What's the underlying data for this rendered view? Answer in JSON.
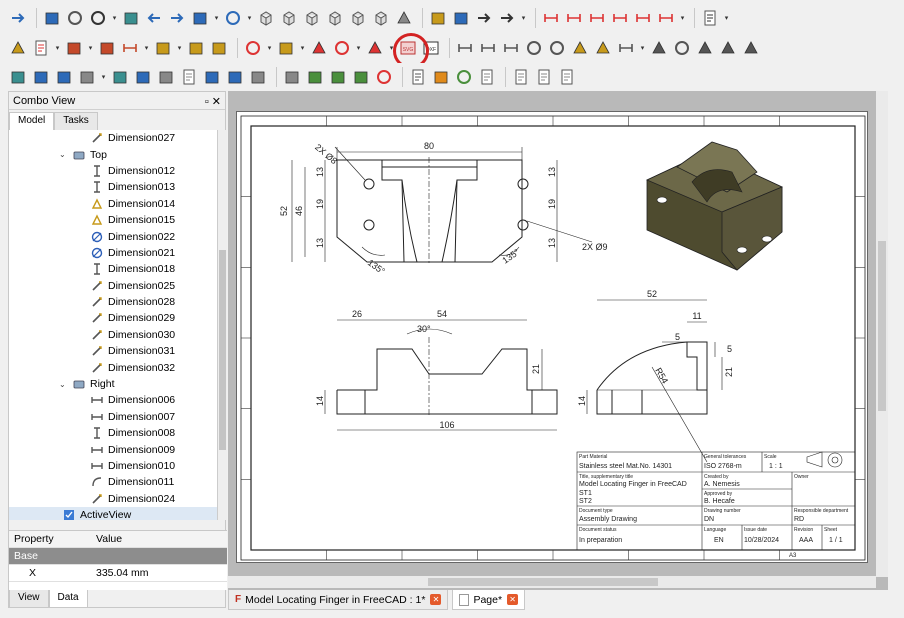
{
  "combo_view": {
    "title": "Combo View",
    "tabs": [
      "Model",
      "Tasks"
    ],
    "tree": [
      {
        "label": "Dimension027",
        "indent": 2,
        "icon": "distance"
      },
      {
        "label": "Top",
        "indent": 1,
        "icon": "view",
        "expanded": true
      },
      {
        "label": "Dimension012",
        "indent": 2,
        "icon": "vertical"
      },
      {
        "label": "Dimension013",
        "indent": 2,
        "icon": "vertical"
      },
      {
        "label": "Dimension014",
        "indent": 2,
        "icon": "angle"
      },
      {
        "label": "Dimension015",
        "indent": 2,
        "icon": "angle"
      },
      {
        "label": "Dimension022",
        "indent": 2,
        "icon": "diameter"
      },
      {
        "label": "Dimension021",
        "indent": 2,
        "icon": "diameter"
      },
      {
        "label": "Dimension018",
        "indent": 2,
        "icon": "vertical"
      },
      {
        "label": "Dimension025",
        "indent": 2,
        "icon": "distance"
      },
      {
        "label": "Dimension028",
        "indent": 2,
        "icon": "distance"
      },
      {
        "label": "Dimension029",
        "indent": 2,
        "icon": "distance"
      },
      {
        "label": "Dimension030",
        "indent": 2,
        "icon": "distance"
      },
      {
        "label": "Dimension031",
        "indent": 2,
        "icon": "distance"
      },
      {
        "label": "Dimension032",
        "indent": 2,
        "icon": "distance"
      },
      {
        "label": "Right",
        "indent": 1,
        "icon": "view",
        "expanded": true
      },
      {
        "label": "Dimension006",
        "indent": 2,
        "icon": "horizontal"
      },
      {
        "label": "Dimension007",
        "indent": 2,
        "icon": "horizontal"
      },
      {
        "label": "Dimension008",
        "indent": 2,
        "icon": "vertical"
      },
      {
        "label": "Dimension009",
        "indent": 2,
        "icon": "horizontal"
      },
      {
        "label": "Dimension010",
        "indent": 2,
        "icon": "horizontal"
      },
      {
        "label": "Dimension011",
        "indent": 2,
        "icon": "radius"
      },
      {
        "label": "Dimension024",
        "indent": 2,
        "icon": "distance"
      },
      {
        "label": "ActiveView",
        "indent": 1,
        "icon": "active",
        "selected": true
      }
    ],
    "properties": {
      "headers": [
        "Property",
        "Value"
      ],
      "group": "Base",
      "rows": [
        {
          "name": "X",
          "value": "335.04 mm"
        }
      ]
    },
    "bottom_tabs": [
      "View",
      "Data"
    ]
  },
  "document_tabs": [
    {
      "label": "Model Locating Finger in FreeCAD : 1*",
      "active": false
    },
    {
      "label": "Page*",
      "active": true
    }
  ],
  "drawing": {
    "dimensions": {
      "top_width": "80",
      "top_holes": "2X Ø8",
      "top_holes2": "2X Ø9",
      "top_h52": "52",
      "top_h46": "46",
      "top_h13a": "13",
      "top_h19a": "19",
      "top_h13b": "13",
      "top_r13a": "13",
      "top_r19": "19",
      "top_r13b": "13",
      "top_ang1": "135°",
      "top_ang2": "135°",
      "front_26": "26",
      "front_54": "54",
      "front_30": "30°",
      "front_21": "21",
      "front_14": "14",
      "front_106": "106",
      "side_52": "52",
      "side_11": "11",
      "side_5a": "5",
      "side_5b": "5",
      "side_R54": "R54",
      "side_21": "21",
      "side_14": "14"
    },
    "title_block": {
      "part_material_label": "Part Material",
      "part_material": "Stainless steel Mat.No. 14301",
      "tolerances_label": "General tolerances",
      "tolerances": "ISO 2768-m",
      "scale_label": "Scale",
      "scale": "1 : 1",
      "title_label": "Title, supplementary title",
      "title": "Model Locating Finger in FreeCAD",
      "st1": "ST1",
      "st2": "ST2",
      "created_label": "Created by",
      "created": "A. Nemesis",
      "owner_label": "Owner",
      "approved_label": "Approved by",
      "approved": "B. Hecafe",
      "doctype_label": "Document type",
      "doctype": "Assembly Drawing",
      "drawing_no_label": "Drawing number",
      "drawing_no": "DN",
      "dept_label": "Responsible department",
      "dept": "RD",
      "status_label": "Document status",
      "status": "In preparation",
      "lang_label": "Language",
      "lang": "EN",
      "issue_label": "Issue date",
      "issue": "10/28/2024",
      "rev_label": "Revision",
      "rev": "AAA",
      "sheet_label": "Sheet",
      "sheet": "1 / 1",
      "size": "A3"
    }
  },
  "colors": {
    "highlight": "#d32222",
    "model": "#5e5a3a",
    "selection": "#dde8f4"
  }
}
